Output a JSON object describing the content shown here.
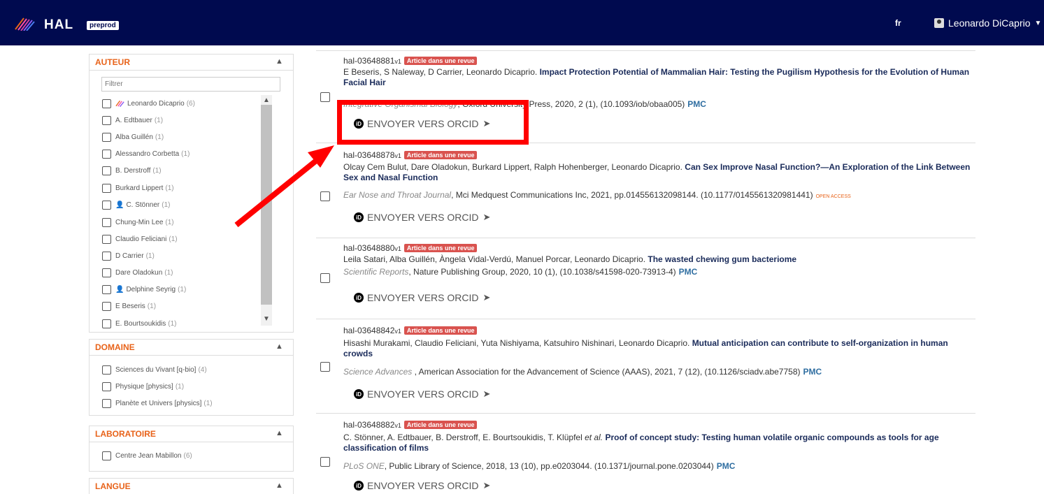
{
  "header": {
    "logo_text": "HAL",
    "env_badge": "preprod",
    "lang": "fr",
    "user_name": "Leonardo DiCaprio"
  },
  "facets": {
    "auteur": {
      "title": "AUTEUR",
      "filter_placeholder": "Filtrer",
      "items": [
        {
          "label": "Leonardo Dicaprio",
          "count": "(6)"
        },
        {
          "label": "A. Edtbauer",
          "count": "(1)"
        },
        {
          "label": "Alba Guillén",
          "count": "(1)"
        },
        {
          "label": "Alessandro Corbetta",
          "count": "(1)"
        },
        {
          "label": "B. Derstroff",
          "count": "(1)"
        },
        {
          "label": "Burkard Lippert",
          "count": "(1)"
        },
        {
          "label": "C. Stönner",
          "count": "(1)"
        },
        {
          "label": "Chung-Min Lee",
          "count": "(1)"
        },
        {
          "label": "Claudio Feliciani",
          "count": "(1)"
        },
        {
          "label": "D Carrier",
          "count": "(1)"
        },
        {
          "label": "Dare Oladokun",
          "count": "(1)"
        },
        {
          "label": "Delphine Seyrig",
          "count": "(1)"
        },
        {
          "label": "E Beseris",
          "count": "(1)"
        },
        {
          "label": "E. Bourtsoukidis",
          "count": "(1)"
        }
      ]
    },
    "domaine": {
      "title": "DOMAINE",
      "items": [
        {
          "label": "Sciences du Vivant [q-bio]",
          "count": "(4)"
        },
        {
          "label": "Physique [physics]",
          "count": "(1)"
        },
        {
          "label": "Planète et Univers [physics]",
          "count": "(1)"
        }
      ]
    },
    "laboratoire": {
      "title": "LABORATOIRE",
      "items": [
        {
          "label": "Centre Jean Mabillon",
          "count": "(6)"
        }
      ]
    },
    "langue": {
      "title": "LANGUE"
    }
  },
  "common": {
    "type_badge": "Article dans une revue",
    "orcid_label": "ENVOYER VERS ORCID",
    "pmc": "PMC",
    "oa": "OPEN ACCESS"
  },
  "results": [
    {
      "id": "hal-03648881",
      "version": "v1",
      "authors": "E Beseris, S Naleway, D Carrier, Leonardo Dicaprio.",
      "title": "Impact Protection Potential of Mammalian Hair: Testing the Pugilism Hypothesis for the Evolution of Human Facial Hair",
      "journal": "Integrative Organismal Biology",
      "rest": ", Oxford University Press, 2020, 2 (1),",
      "doi": "(10.1093/iob/obaa005)"
    },
    {
      "id": "hal-03648878",
      "version": "v1",
      "authors": "Olcay Cem Bulut, Dare Oladokun, Burkard Lippert, Ralph Hohenberger, Leonardo Dicaprio.",
      "title": "Can Sex Improve Nasal Function?—An Exploration of the Link Between Sex and Nasal Function",
      "journal": "Ear Nose and Throat Journal",
      "rest": ", Mci Medquest Communications Inc, 2021, pp.014556132098144.",
      "doi": "(10.1177/0145561320981441)"
    },
    {
      "id": "hal-03648880",
      "version": "v1",
      "authors": "Leila Satari, Alba Guillén, Àngela Vidal-Verdú, Manuel Porcar, Leonardo Dicaprio.",
      "title": "The wasted chewing gum bacteriome",
      "journal": "Scientific Reports",
      "rest": ", Nature Publishing Group, 2020, 10 (1),",
      "doi": "(10.1038/s41598-020-73913-4)"
    },
    {
      "id": "hal-03648842",
      "version": "v1",
      "authors": "Hisashi Murakami, Claudio Feliciani, Yuta Nishiyama, Katsuhiro Nishinari, Leonardo Dicaprio.",
      "title": "Mutual anticipation can contribute to self-organization in human crowds",
      "journal": "Science Advances",
      "rest": " , American Association for the Advancement of Science (AAAS), 2021, 7 (12),",
      "doi": "(10.1126/sciadv.abe7758)"
    },
    {
      "id": "hal-03648882",
      "version": "v1",
      "authors": "C. Stönner, A. Edtbauer, B. Derstroff, E. Bourtsoukidis, T. Klüpfel",
      "etal": "et al.",
      "title": "Proof of concept study: Testing human volatile organic compounds as tools for age classification of films",
      "journal": "PLoS ONE",
      "rest": ", Public Library of Science, 2018, 13 (10), pp.e0203044.",
      "doi": "(10.1371/journal.pone.0203044)"
    }
  ],
  "colors": {
    "header_bg": "#000a4f",
    "facet_title": "#e8631a",
    "badge": "#d9534f",
    "annotation": "#ff0000"
  }
}
